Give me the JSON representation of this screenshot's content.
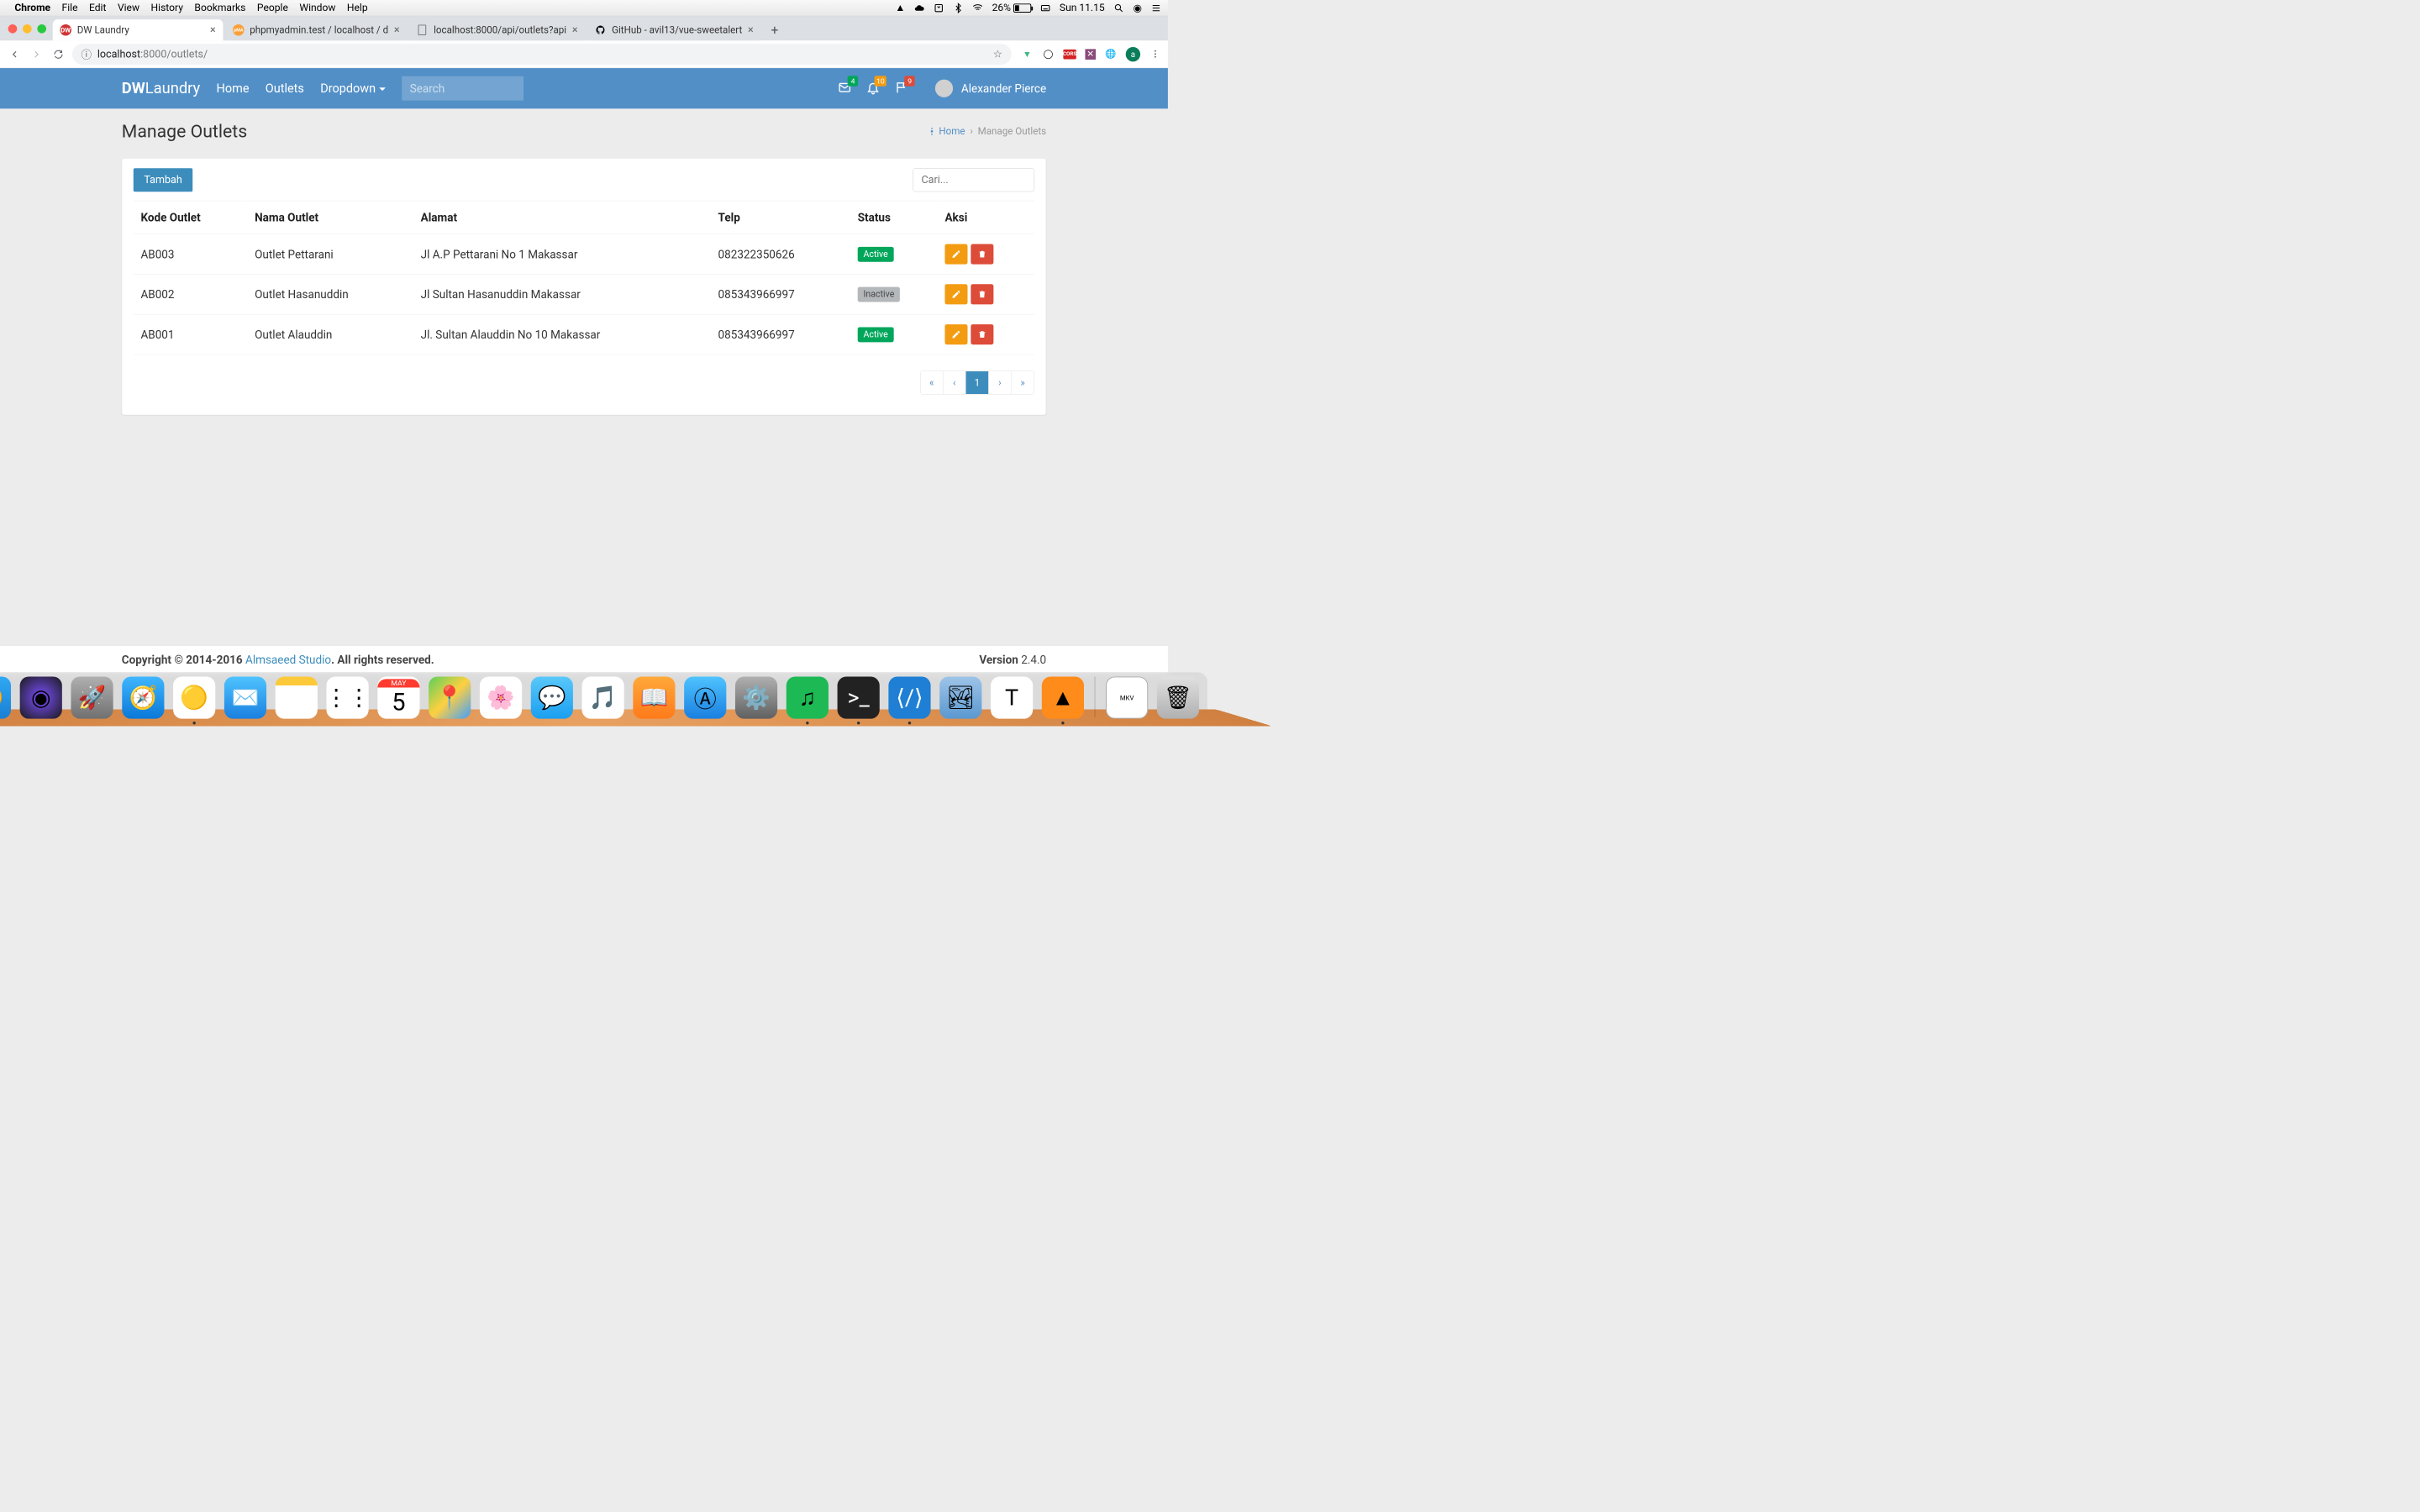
{
  "menubar": {
    "app": "Chrome",
    "items": [
      "File",
      "Edit",
      "View",
      "History",
      "Bookmarks",
      "People",
      "Window",
      "Help"
    ],
    "battery_pct": "26%",
    "clock": "Sun 11.15"
  },
  "tabs": [
    {
      "title": "DW Laundry",
      "active": true,
      "fav": "red",
      "favtxt": "DW"
    },
    {
      "title": "phpmyadmin.test / localhost / d",
      "active": false,
      "fav": "pma",
      "favtxt": "pMA"
    },
    {
      "title": "localhost:8000/api/outlets?api",
      "active": false,
      "fav": "doc",
      "favtxt": ""
    },
    {
      "title": "GitHub - avil13/vue-sweetalert",
      "active": false,
      "fav": "gh",
      "favtxt": ""
    }
  ],
  "url": {
    "host": "localhost",
    "port_path": ":8000/outlets/"
  },
  "brand_bold": "DW",
  "brand_light": "Laundry",
  "nav": {
    "home": "Home",
    "outlets": "Outlets",
    "dropdown": "Dropdown"
  },
  "search_placeholder": "Search",
  "badges": {
    "mail": "4",
    "bell": "10",
    "flag": "9"
  },
  "user": "Alexander Pierce",
  "page_title": "Manage Outlets",
  "crumb_home": "Home",
  "crumb_current": "Manage Outlets",
  "btn_tambah": "Tambah",
  "cari_placeholder": "Cari...",
  "table": {
    "headers": [
      "Kode Outlet",
      "Nama Outlet",
      "Alamat",
      "Telp",
      "Status",
      "Aksi"
    ],
    "rows": [
      {
        "kode": "AB003",
        "nama": "Outlet Pettarani",
        "alamat": "Jl A.P Pettarani No 1 Makassar",
        "telp": "082322350626",
        "status": "Active"
      },
      {
        "kode": "AB002",
        "nama": "Outlet Hasanuddin",
        "alamat": "Jl Sultan Hasanuddin Makassar",
        "telp": "085343966997",
        "status": "Inactive"
      },
      {
        "kode": "AB001",
        "nama": "Outlet Alauddin",
        "alamat": "Jl. Sultan Alauddin No 10 Makassar",
        "telp": "085343966997",
        "status": "Active"
      }
    ]
  },
  "pagination": [
    "«",
    "‹",
    "1",
    "›",
    "»"
  ],
  "footer": {
    "copy": "Copyright © 2014-2016 ",
    "studio": "Almsaeed Studio",
    "rights": ". All rights reserved.",
    "ver_label": "Version ",
    "ver": "2.4.0"
  },
  "avatar_letter": "a"
}
